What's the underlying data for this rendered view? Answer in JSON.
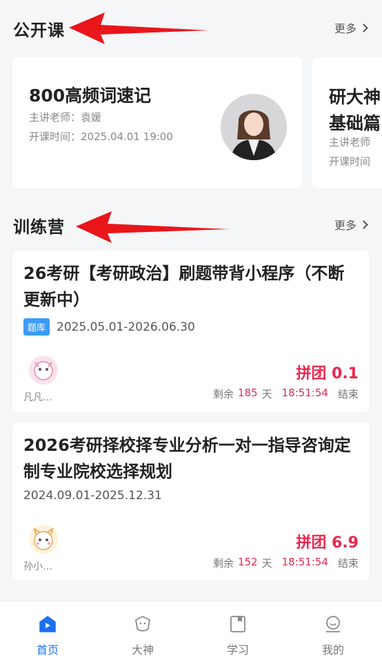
{
  "public_course": {
    "title": "公开课",
    "more_label": "更多",
    "cards": [
      {
        "title": "800高频词速记",
        "teacher_label": "主讲老师：袁媛",
        "time_label": "开课时间：2025.04.01 19:00"
      },
      {
        "title_line1": "研大神",
        "title_line2": "基础篇",
        "teacher_label": "主讲老师",
        "time_label": "开课时间"
      }
    ]
  },
  "training_camp": {
    "title": "训练营",
    "more_label": "更多",
    "items": [
      {
        "title": "26考研【考研政治】刷题带背小程序（不断更新中）",
        "badge": "题库",
        "date_range": "2025.05.01-2026.06.30",
        "user_name": "凡凡…",
        "price": "拼团 0.1",
        "remain_prefix": "剩余",
        "remain_days": "185",
        "days_unit": "天",
        "end_time": "18:51:54",
        "end_suffix": "结束"
      },
      {
        "title": "2026考研择校择专业分析一对一指导咨询定制专业院校选择规划",
        "date_range": "2024.09.01-2025.12.31",
        "user_name": "孙小…",
        "price": "拼团 6.9",
        "remain_prefix": "剩余",
        "remain_days": "152",
        "days_unit": "天",
        "end_time": "18:51:54",
        "end_suffix": "结束"
      }
    ]
  },
  "tabbar": {
    "tabs": [
      {
        "label": "首页",
        "icon": "home-icon",
        "active": true
      },
      {
        "label": "大神",
        "icon": "mascot-icon",
        "active": false
      },
      {
        "label": "学习",
        "icon": "book-icon",
        "active": false
      },
      {
        "label": "我的",
        "icon": "profile-icon",
        "active": false
      }
    ]
  },
  "colors": {
    "accent": "#1f6ff0",
    "price_red": "#e8284d",
    "badge_blue": "#3b9cf6",
    "annotation_arrow": "#e8161b"
  }
}
